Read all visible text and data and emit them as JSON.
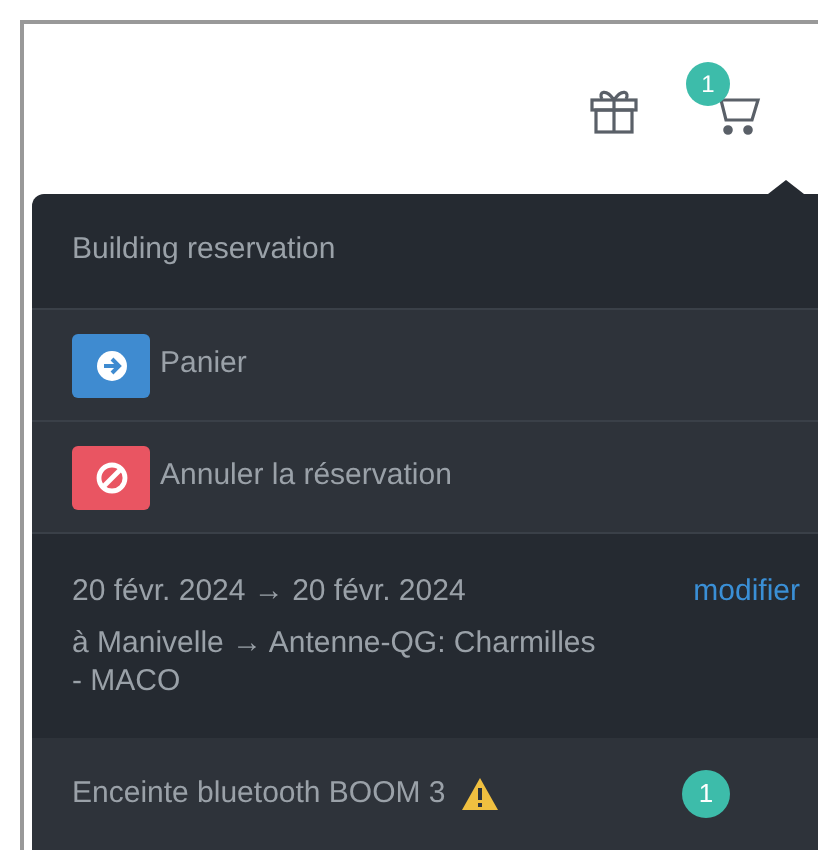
{
  "header": {
    "cart_count": "1"
  },
  "dropdown": {
    "title": "Building reservation",
    "actions": [
      {
        "kind": "primary",
        "label": "Panier"
      },
      {
        "kind": "danger",
        "label": "Annuler la réservation"
      }
    ],
    "dates": "20 févr. 2024 → 20 févr. 2024",
    "edit_link": "modifier",
    "route": "à Manivelle → Antenne-QG: Charmilles - MACO",
    "items": [
      {
        "name": "Enceinte bluetooth BOOM 3",
        "warning": true,
        "quantity": "1"
      }
    ]
  }
}
